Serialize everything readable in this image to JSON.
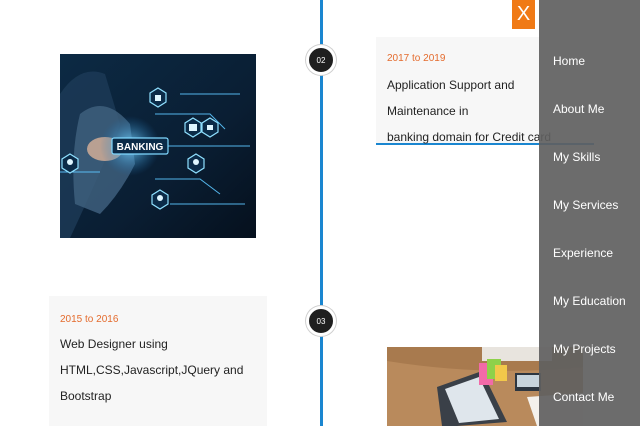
{
  "timeline": {
    "nodes": [
      "02",
      "03"
    ],
    "items": [
      {
        "date": "2017 to 2019",
        "lines": [
          "Application Support and Maintenance in",
          "banking domain for Credit card"
        ]
      },
      {
        "date": "2015 to 2016",
        "lines": [
          "Web Designer using",
          "HTML,CSS,Javascript,JQuery and",
          "Bootstrap"
        ]
      }
    ],
    "banking_label": "BANKING"
  },
  "menu": {
    "close_label": "X",
    "items": [
      "Home",
      "About Me",
      "My Skills",
      "My Services",
      "Experience",
      "My Education",
      "My Projects",
      "Contact Me"
    ]
  },
  "colors": {
    "accent_blue": "#1a86d0",
    "accent_orange": "#e46b2d",
    "close_orange": "#f07a16",
    "menu_bg": "#5f5f5f"
  },
  "icons": [
    "close-icon"
  ]
}
